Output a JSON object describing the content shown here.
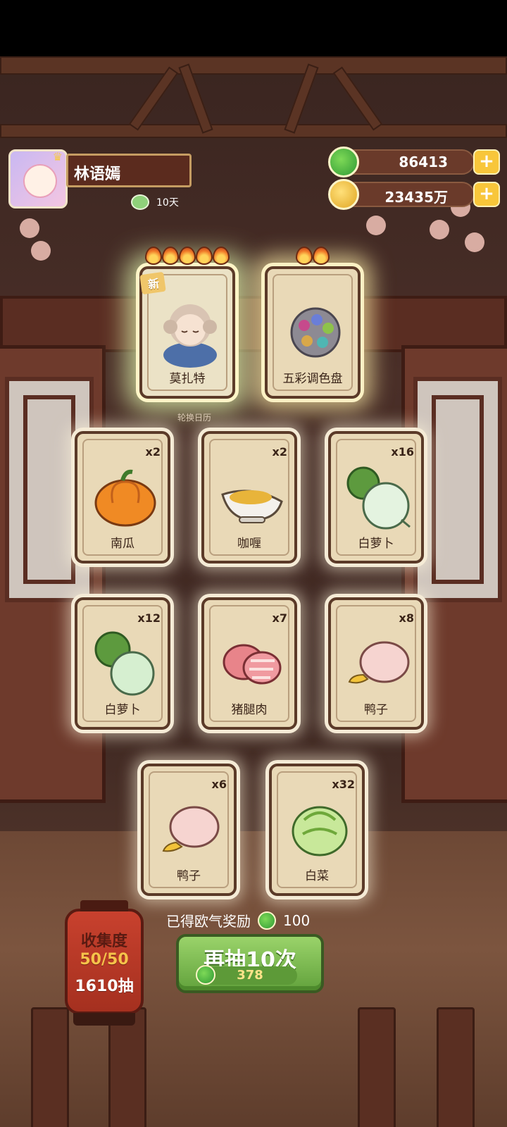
{
  "player": {
    "name": "林语嫣",
    "days": "10天"
  },
  "currency": {
    "jade": "86413",
    "coins": "23435万"
  },
  "featured": [
    {
      "name": "莫扎特",
      "new_tag": "新",
      "stars": 5
    },
    {
      "name": "五彩调色盘",
      "stars": 2
    }
  ],
  "calendar_text": "轮换日历",
  "cards": [
    {
      "name": "南瓜",
      "count": "x2"
    },
    {
      "name": "咖喱",
      "count": "x2"
    },
    {
      "name": "白萝卜",
      "count": "x16"
    },
    {
      "name": "白萝卜",
      "count": "x12"
    },
    {
      "name": "猪腿肉",
      "count": "x7"
    },
    {
      "name": "鸭子",
      "count": "x8"
    },
    {
      "name": "鸭子",
      "count": "x6"
    },
    {
      "name": "白菜",
      "count": "x32"
    }
  ],
  "reward": {
    "label": "已得欧气奖励",
    "value": "100"
  },
  "draw_button": {
    "label": "再抽10次",
    "cost": "378"
  },
  "collection": {
    "title": "收集度",
    "progress": "50/50",
    "draws": "1610抽"
  },
  "colors": {
    "jade": "#3aa63a",
    "coin": "#f0b42e",
    "draw_button": "#7fbf4f",
    "lantern": "#b8392a"
  }
}
